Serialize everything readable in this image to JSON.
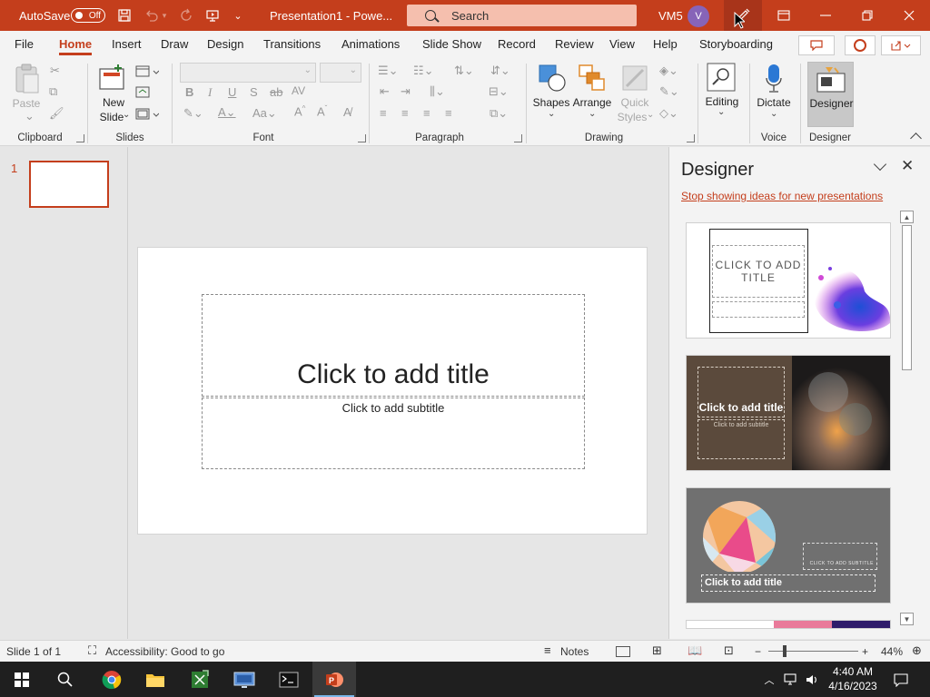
{
  "colors": {
    "accent": "#c43e1c",
    "title_bar": "#c43e1c",
    "taskbar": "#1f1f1f",
    "avatar": "#8764b8"
  },
  "titlebar": {
    "autosave_label": "AutoSave",
    "autosave_state": "Off",
    "doc_title": "Presentation1  -  Powe...",
    "search_placeholder": "Search",
    "user_initials": "VM5",
    "avatar_letter": "V",
    "icons": [
      "save-icon",
      "undo-icon",
      "redo-icon",
      "present-from-start-icon",
      "customize-qat-icon",
      "pen-icon",
      "ribbon-display-icon",
      "minimize-icon",
      "restore-icon",
      "close-icon"
    ]
  },
  "menu": {
    "tabs": [
      "File",
      "Home",
      "Insert",
      "Draw",
      "Design",
      "Transitions",
      "Animations",
      "Slide Show",
      "Record",
      "Review",
      "View",
      "Help",
      "Storyboarding"
    ],
    "active": "Home"
  },
  "ribbon": {
    "groups": {
      "clipboard": "Clipboard",
      "slides": "Slides",
      "font": "Font",
      "paragraph": "Paragraph",
      "drawing": "Drawing",
      "voice": "Voice",
      "designer": "Designer"
    },
    "paste_label": "Paste",
    "new_slide_line1": "New",
    "new_slide_line2": "Slide",
    "shapes_label": "Shapes",
    "arrange_label": "Arrange",
    "quick_styles_line1": "Quick",
    "quick_styles_line2": "Styles",
    "editing_label": "Editing",
    "dictate_label": "Dictate",
    "designer_label": "Designer"
  },
  "thumbnails": {
    "slide_number": "1"
  },
  "slide": {
    "title_placeholder": "Click to add title",
    "subtitle_placeholder": "Click to add subtitle"
  },
  "designer_pane": {
    "title": "Designer",
    "stop_link": "Stop showing ideas for new presentations",
    "design1_title": "CLICK TO ADD TITLE",
    "design2_title": "Click to add title",
    "design2_subtitle": "Click to add subtitle",
    "design3_title": "Click to add title",
    "design3_subtitle": "CLICK TO ADD SUBTITLE"
  },
  "statusbar": {
    "slide_info": "Slide 1 of 1",
    "accessibility": "Accessibility: Good to go",
    "notes_label": "Notes",
    "zoom_minus": "−",
    "zoom_plus": "+",
    "zoom_level": "44%"
  },
  "taskbar": {
    "apps": [
      "chrome-icon",
      "file-explorer-icon",
      "excel-like-icon",
      "remote-desktop-icon",
      "terminal-icon",
      "powerpoint-icon"
    ],
    "time": "4:40 AM",
    "date": "4/16/2023"
  }
}
